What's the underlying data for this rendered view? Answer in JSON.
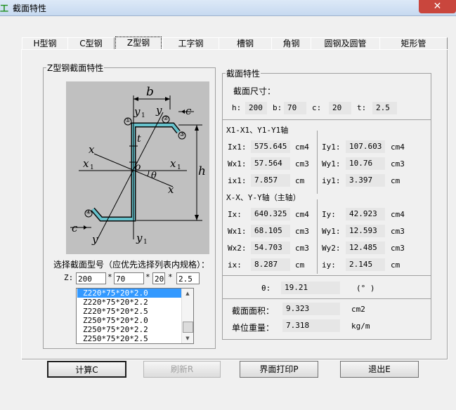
{
  "window": {
    "title": "截面特性",
    "app_icon_text": "工"
  },
  "tabs": [
    {
      "label": "H型钢"
    },
    {
      "label": "C型钢"
    },
    {
      "label": "Z型钢"
    },
    {
      "label": "工字钢"
    },
    {
      "label": "槽钢"
    },
    {
      "label": "角钢"
    },
    {
      "label": "圆钢及圆管"
    },
    {
      "label": "矩形管"
    }
  ],
  "active_tab": "Z型钢",
  "left_group": {
    "title": "Z型钢截面特性"
  },
  "diagram": {
    "labels": {
      "b": "b",
      "y1_top": "y",
      "y_top": "y",
      "c_top": "c",
      "c_bottom": "c",
      "t": "t",
      "x_left": "x",
      "x1_left": "x",
      "o": "o",
      "x1_right": "x",
      "theta": "θ",
      "x_right": "x",
      "h": "h",
      "y_bottom": "y",
      "y1_bottom": "y",
      "sub1": "1",
      "circle1": "①",
      "circle2": "②",
      "circle3": "③",
      "circle4": "④"
    },
    "profile_color": "#66c2cc"
  },
  "selection": {
    "prompt": "选择截面型号（应优先选择列表内规格）：",
    "prefix": "Z:",
    "h": "200",
    "b": "70",
    "c": "20",
    "t": "2.5",
    "sep": "*"
  },
  "list": {
    "items": [
      "Z220*75*20*2.0",
      "Z220*75*20*2.2",
      "Z220*75*20*2.5",
      "Z250*75*20*2.0",
      "Z250*75*20*2.2",
      "Z250*75*20*2.5"
    ],
    "selected_index": 0,
    "scroll_up": "▲",
    "scroll_down": "▼"
  },
  "right_group": {
    "title": "截面特性",
    "size_label": "截面尺寸：",
    "dims": [
      {
        "label": "h:",
        "value": "200"
      },
      {
        "label": "b:",
        "value": "70"
      },
      {
        "label": "c:",
        "value": "20"
      },
      {
        "label": "t:",
        "value": "2.5"
      }
    ],
    "axis1_title": "X1-X1、Y1-Y1轴",
    "axis1": [
      {
        "label": "Ix1:",
        "value": "575.645",
        "unit": "cm4",
        "label2": "Iy1:",
        "value2": "107.603",
        "unit2": "cm4"
      },
      {
        "label": "Wx1:",
        "value": "57.564",
        "unit": "cm3",
        "label2": "Wy1:",
        "value2": "10.76",
        "unit2": "cm3"
      },
      {
        "label": "ix1:",
        "value": "7.857",
        "unit": "cm",
        "label2": "iy1:",
        "value2": "3.397",
        "unit2": "cm"
      }
    ],
    "axis2_title": "X-X、Y-Y轴（主轴）",
    "axis2": [
      {
        "label": "Ix:",
        "value": "640.325",
        "unit": "cm4",
        "label2": "Iy:",
        "value2": "42.923",
        "unit2": "cm4"
      },
      {
        "label": "Wx1:",
        "value": "68.105",
        "unit": "cm3",
        "label2": "Wy1:",
        "value2": "12.593",
        "unit2": "cm3"
      },
      {
        "label": "Wx2:",
        "value": "54.703",
        "unit": "cm3",
        "label2": "Wy2:",
        "value2": "12.485",
        "unit2": "cm3"
      },
      {
        "label": "ix:",
        "value": "8.287",
        "unit": "cm",
        "label2": "iy:",
        "value2": "2.145",
        "unit2": "cm"
      }
    ],
    "theta": {
      "label": "θ:",
      "value": "19.21",
      "unit": "(° )"
    },
    "area": {
      "label": "截面面积：",
      "value": "9.323",
      "unit": "cm2"
    },
    "weight": {
      "label": "单位重量：",
      "value": "7.318",
      "unit": "kg/m"
    }
  },
  "buttons": {
    "calc": "计算C",
    "refresh": "刷新R",
    "print": "界面打印P",
    "exit": "退出E"
  }
}
